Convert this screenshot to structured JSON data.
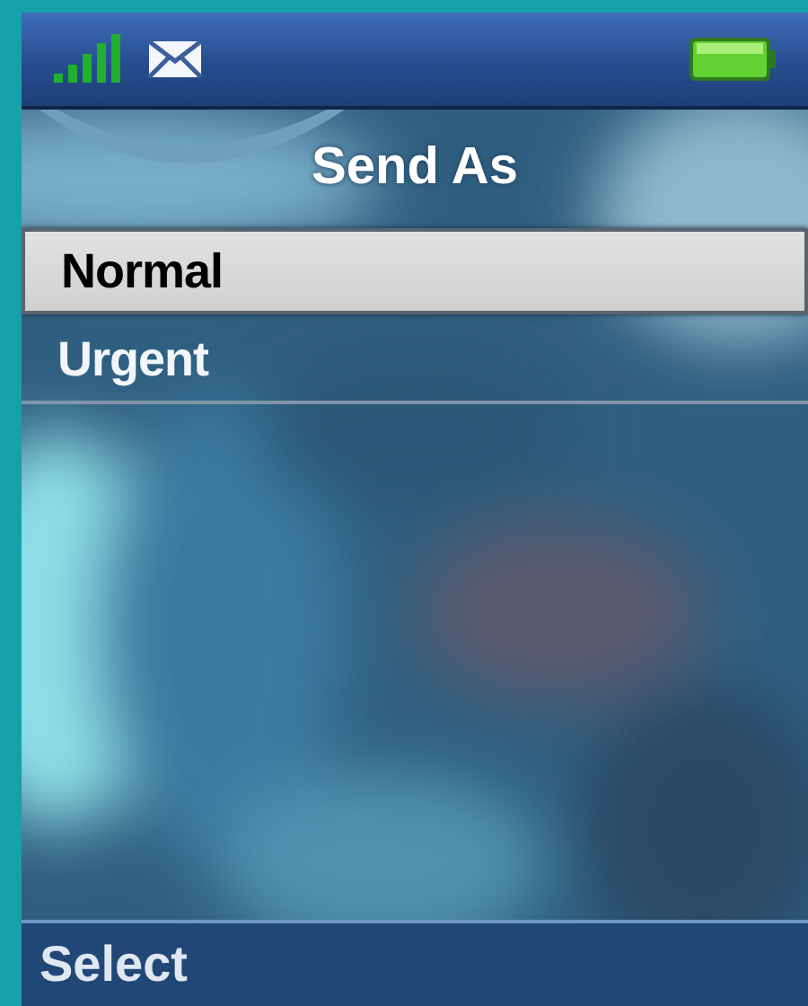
{
  "title": "Send As",
  "items": [
    {
      "label": "Normal",
      "selected": true
    },
    {
      "label": "Urgent",
      "selected": false
    }
  ],
  "softkey": {
    "label": "Select"
  }
}
